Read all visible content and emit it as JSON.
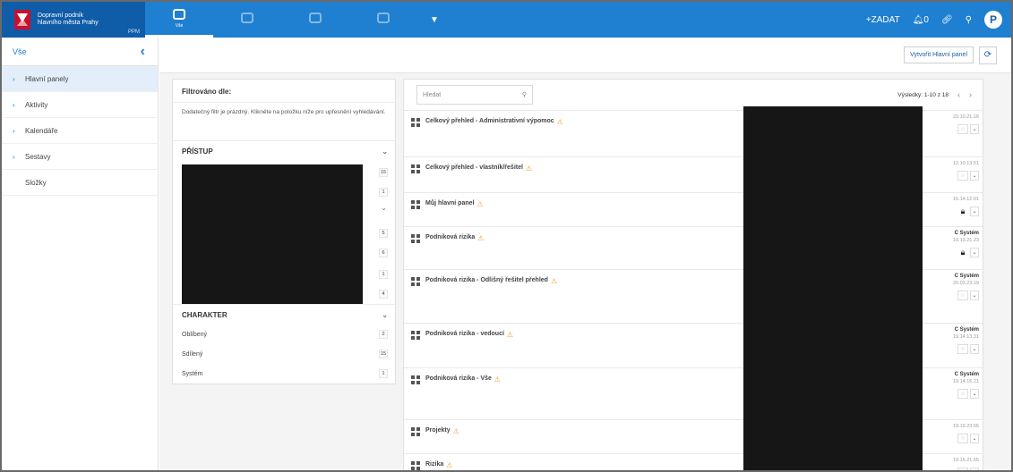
{
  "brand": {
    "name_line1": "Dopravní podnik",
    "name_line2": "hlavního města Prahy",
    "sub": "PPM"
  },
  "nav": {
    "tabs": [
      "Vše",
      "",
      "",
      ""
    ]
  },
  "topbar": {
    "create_label": "+ZADAT",
    "notifications": "0",
    "avatar_letter": "P"
  },
  "sidebar": {
    "title": "Vše",
    "items": [
      {
        "label": "Hlavní panely",
        "active": true,
        "arrow": true
      },
      {
        "label": "Aktivity",
        "arrow": true
      },
      {
        "label": "Kalendáře",
        "arrow": true
      },
      {
        "label": "Sestavy",
        "arrow": true
      },
      {
        "label": "Složky",
        "arrow": false
      }
    ]
  },
  "toolbar": {
    "create_dashboard": "Vytvořit Hlavní panel"
  },
  "filter": {
    "title": "Filtrováno dle:",
    "description": "Dodatečný filtr je prázdný. Klikněte na položku níže pro upřesnění vyhledávání.",
    "access": {
      "label": "PŘÍSTUP",
      "counts": [
        "15",
        "1",
        "5",
        "6",
        "1",
        "4"
      ]
    },
    "character": {
      "label": "CHARAKTER",
      "rows": [
        {
          "label": "Oblíbený",
          "count": "2"
        },
        {
          "label": "Sdílený",
          "count": "15"
        },
        {
          "label": "Systém",
          "count": "1"
        }
      ]
    }
  },
  "results": {
    "search_placeholder": "Hledat",
    "pager_text": "Výsledky: 1-10 z 18",
    "rows": [
      {
        "name": "Celkový přehled - Administrativní výpomoc",
        "date": "23.10.21.16",
        "system": "",
        "lock": false
      },
      {
        "name": "Celkový přehled - vlastník/řešitel",
        "date": "12.10.13.51",
        "system": "",
        "lock": false
      },
      {
        "name": "Můj hlavní panel",
        "date": "16.14.12.01",
        "system": "",
        "lock": true
      },
      {
        "name": "Podniková rizika",
        "date": "19.13.21.23",
        "system": "C Systém",
        "lock": true
      },
      {
        "name": "Podniková rizika - Odlišný řešitel přehled",
        "date": "20.03.23.19",
        "system": "C Systém",
        "lock": false
      },
      {
        "name": "Podniková rizika - vedoucí",
        "date": "19.14.13.31",
        "system": "C Systém",
        "lock": false
      },
      {
        "name": "Podniková rizika - Vše",
        "date": "19.14.15.21",
        "system": "C Systém",
        "lock": false
      },
      {
        "name": "Projekty",
        "date": "19.19.23.55",
        "system": "",
        "lock": false
      },
      {
        "name": "Rizika",
        "date": "19.15.21.55",
        "system": "",
        "lock": false
      }
    ]
  }
}
